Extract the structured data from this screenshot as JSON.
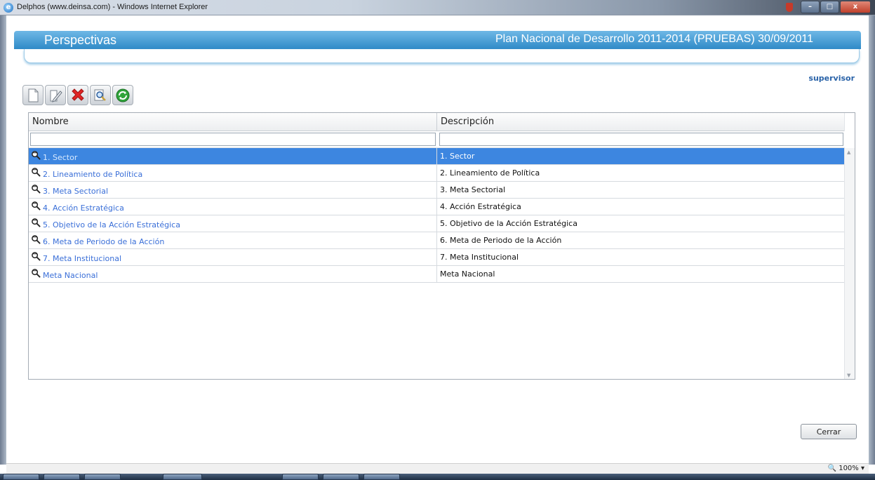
{
  "window": {
    "title": "Delphos (www.deinsa.com) - Windows Internet Explorer",
    "controls": {
      "minimize": "–",
      "maximize": "□",
      "close": "x"
    }
  },
  "header": {
    "title": "Perspectivas",
    "plan": "Plan Nacional de Desarrollo 2011-2014 (PRUEBAS) 30/09/2011"
  },
  "user": "supervisor",
  "toolbar": {
    "icons": [
      "new-document-icon",
      "edit-icon",
      "delete-icon",
      "search-icon",
      "refresh-icon"
    ]
  },
  "grid": {
    "columns": [
      "Nombre",
      "Descripción"
    ],
    "filters": [
      "",
      ""
    ],
    "rows": [
      {
        "nombre": "1. Sector",
        "descripcion": "1. Sector",
        "selected": true
      },
      {
        "nombre": "2. Lineamiento de Política",
        "descripcion": "2. Lineamiento de Política"
      },
      {
        "nombre": "3. Meta Sectorial",
        "descripcion": "3. Meta Sectorial"
      },
      {
        "nombre": "4. Acción Estratégica",
        "descripcion": "4. Acción Estratégica"
      },
      {
        "nombre": "5. Objetivo de la Acción Estratégica",
        "descripcion": "5. Objetivo de la Acción Estratégica"
      },
      {
        "nombre": "6. Meta de Periodo de la Acción",
        "descripcion": "6. Meta de Periodo de la Acción"
      },
      {
        "nombre": "7. Meta Institucional",
        "descripcion": "7. Meta Institucional"
      },
      {
        "nombre": "Meta Nacional",
        "descripcion": "Meta Nacional"
      }
    ]
  },
  "buttons": {
    "close": "Cerrar"
  },
  "statusbar": {
    "zoom": "100%"
  },
  "colors": {
    "header": "#2f8ac7",
    "selected_row": "#3d86e0",
    "link": "#3a6fd8"
  }
}
